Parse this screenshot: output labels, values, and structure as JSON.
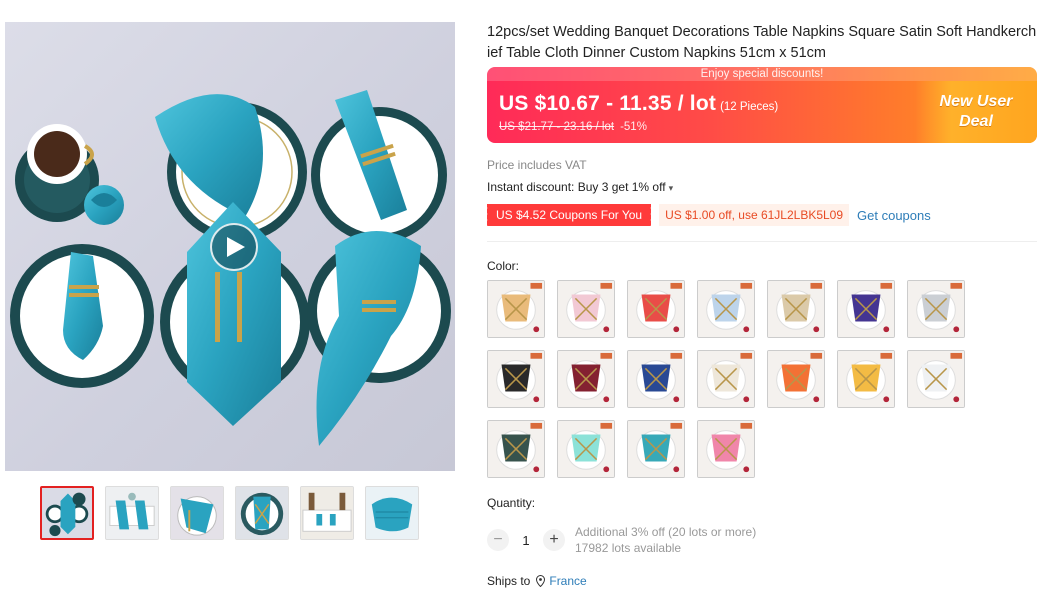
{
  "product": {
    "title": "12pcs/set Wedding Banquet Decorations Table Napkins Square Satin Soft Handkerchief Table Cloth Dinner Custom Napkins 51cm x 51cm"
  },
  "price": {
    "banner_top": "Enjoy special discounts!",
    "range": "US $10.67 - 11.35 / lot",
    "pieces": "(12 Pieces)",
    "original": "US $21.77 - 23.16 / lot",
    "discount": "-51%",
    "deal_line1": "New User",
    "deal_line2": "Deal"
  },
  "vat": "Price includes VAT",
  "instant_discount": "Instant discount: Buy 3 get 1% off",
  "coupons": {
    "store_coupon": "US $4.52 Coupons For You",
    "code_coupon": "US $1.00 off, use 61JL2LBK5L09",
    "get_link": "Get coupons"
  },
  "color": {
    "label": "Color:",
    "options": [
      "champagne-gold",
      "pink",
      "red",
      "light-blue",
      "champagne",
      "purple",
      "silver-gray",
      "black",
      "burgundy",
      "navy-blue",
      "ivory",
      "orange",
      "yellow-gold",
      "white",
      "dark-green",
      "mint",
      "teal",
      "rose-pink"
    ],
    "swatch_colors": [
      "#e8b774",
      "#f1c6d2",
      "#e8433e",
      "#b9d2ea",
      "#d9c7a4",
      "#3a2a8c",
      "#c8ccd2",
      "#1d1d1f",
      "#7d1526",
      "#1e3f8e",
      "#ede6d8",
      "#f2692a",
      "#f2b73a",
      "#eef0f2",
      "#2c4a43",
      "#86e0d6",
      "#2ca4b4",
      "#ef7fa5"
    ]
  },
  "quantity": {
    "label": "Quantity:",
    "value": "1",
    "minus": "−",
    "plus": "+",
    "additional": "Additional 3% off (20 lots or more)",
    "available": "17982 lots available"
  },
  "shipping": {
    "label": "Ships to",
    "country": "France"
  },
  "gallery": {
    "thumb_count": 6,
    "active_index": 0
  },
  "colors": {
    "accent_red": "#e32121",
    "link_blue": "#2e7db8",
    "napkin_teal": "#2aa3c0"
  }
}
